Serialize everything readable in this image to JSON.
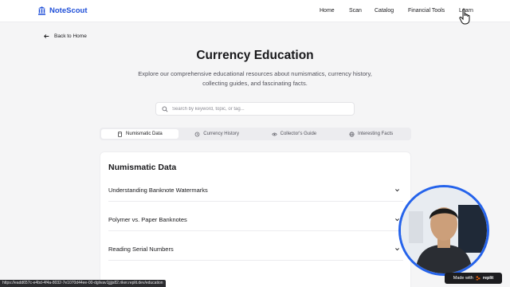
{
  "header": {
    "brand": "NoteScout",
    "nav": [
      "Home",
      "Scan",
      "Catalog",
      "Financial Tools",
      "Learn"
    ]
  },
  "back_link": "Back to Home",
  "hero": {
    "title": "Currency Education",
    "subtitle": "Explore our comprehensive educational resources about numismatics, currency history, collecting guides, and fascinating facts."
  },
  "search": {
    "placeholder": "Search by keyword, topic, or tag...",
    "value": ""
  },
  "tabs": [
    {
      "label": "Numismatic Data",
      "icon": "book-icon",
      "active": true
    },
    {
      "label": "Currency History",
      "icon": "history-icon",
      "active": false
    },
    {
      "label": "Collector's Guide",
      "icon": "eye-icon",
      "active": false
    },
    {
      "label": "Interesting Facts",
      "icon": "globe-icon",
      "active": false
    }
  ],
  "section": {
    "title": "Numismatic Data",
    "items": [
      "Understanding Banknote Watermarks",
      "Polymer vs. Paper Banknotes",
      "Reading Serial Numbers"
    ]
  },
  "status_url": "https://eadd657c-e4bd-4f4a-8032-7e1070d44ee-00-dglivav1jjjjs82.riker.replit.dev/education",
  "badge": {
    "prefix": "Made with",
    "brand": "replit"
  },
  "colors": {
    "accent": "#1f4fd8",
    "webcam_ring": "#2563eb",
    "background": "#f5f5f6"
  }
}
